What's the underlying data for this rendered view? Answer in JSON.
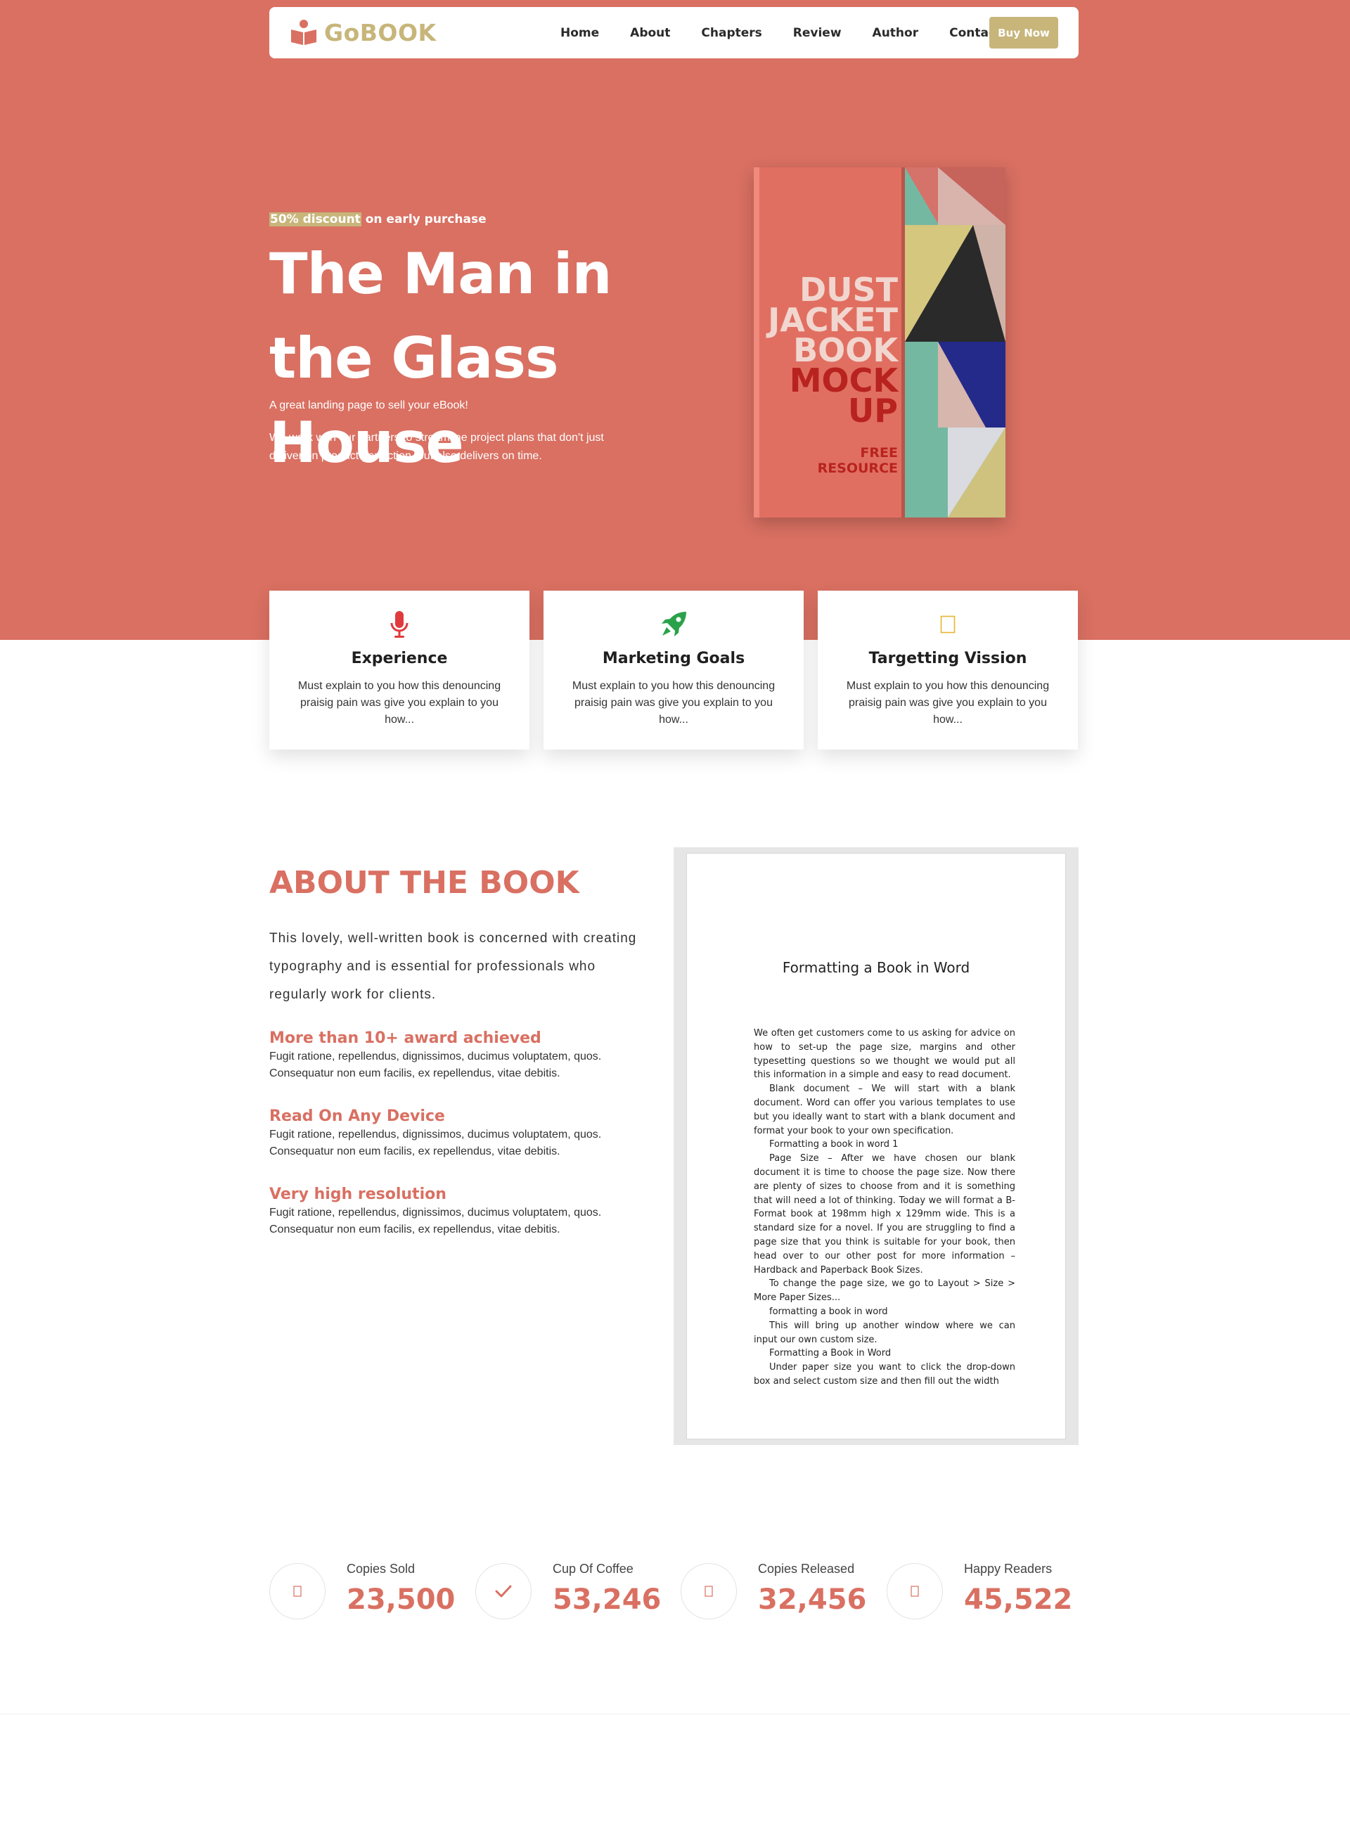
{
  "brand": {
    "name": "GoBOOK",
    "color": "#c7b57a",
    "accent": "#d97062"
  },
  "nav": {
    "items": [
      "Home",
      "About",
      "Chapters",
      "Review",
      "Author",
      "Contact"
    ],
    "cta": "Buy Now"
  },
  "hero": {
    "kicker_highlight": "50% discount",
    "kicker_rest": " on early purchase",
    "title": "The Man in the Glass House",
    "tagline": "A great landing page to sell your eBook!",
    "description": "We work with our partners to streamline project plans that don't just deliver on product perfection, but also delivers on time.",
    "book_cover": {
      "lines": [
        "DUST",
        "JACKET",
        "BOOK",
        "MOCK",
        "UP"
      ],
      "footer": [
        "FREE",
        "RESOURCE"
      ]
    }
  },
  "features": [
    {
      "icon": "microphone-icon",
      "title": "Experience",
      "text": "Must explain to you how this denouncing praisig pain was give you explain to you how..."
    },
    {
      "icon": "rocket-icon",
      "title": "Marketing Goals",
      "text": "Must explain to you how this denouncing praisig pain was give you explain to you how..."
    },
    {
      "icon": "missing-glyph-icon",
      "title": "Targetting Vission",
      "text": "Must explain to you how this denouncing praisig pain was give you explain to you how..."
    }
  ],
  "about": {
    "title": "ABOUT THE BOOK",
    "lead": "This lovely, well-written book is concerned with creating typography and is essential for professionals who regularly work for clients.",
    "points": [
      {
        "title": "More than 10+ award achieved",
        "text": "Fugit ratione, repellendus, dignissimos, ducimus voluptatem, quos. Consequatur non eum facilis, ex repellendus, vitae debitis."
      },
      {
        "title": "Read On Any Device",
        "text": "Fugit ratione, repellendus, dignissimos, ducimus voluptatem, quos. Consequatur non eum facilis, ex repellendus, vitae debitis."
      },
      {
        "title": "Very high resolution",
        "text": "Fugit ratione, repellendus, dignissimos, ducimus voluptatem, quos. Consequatur non eum facilis, ex repellendus, vitae debitis."
      }
    ],
    "document": {
      "title": "Formatting a Book in Word",
      "paragraphs": [
        {
          "text": "We often get customers come to us asking for advice on how to set-up the page size, margins and other typesetting questions so we thought we would put all this information in a simple and easy to read document.",
          "indent": false
        },
        {
          "text": "Blank document – We will start with a blank document. Word can offer you various templates to use but you ideally want to start with a blank document and format your book to your own specification.",
          "indent": true
        },
        {
          "text": "Formatting a book in word 1",
          "indent": true
        },
        {
          "text": "Page Size – After we have chosen our blank document it is time to choose the page size. Now there are plenty of sizes to choose from and it is something that will need a lot of thinking. Today we will format a B-Format book at 198mm high x 129mm wide. This is a standard size for a novel. If you are struggling to find a page size that you think is suitable for your book, then head over to our other post for more information – Hardback and Paperback Book Sizes.",
          "indent": true
        },
        {
          "text": "To change the page size, we go to Layout > Size > More Paper Sizes...",
          "indent": true
        },
        {
          "text": "formatting a book in word",
          "indent": true
        },
        {
          "text": "This will bring up another window where we can input our own custom size.",
          "indent": true
        },
        {
          "text": "Formatting a Book in Word",
          "indent": true
        },
        {
          "text": "Under paper size you want to click the drop-down box and select custom size and then fill out the width",
          "indent": true
        }
      ]
    }
  },
  "stats": [
    {
      "icon": "missing-glyph-icon",
      "label": "Copies Sold",
      "value": "23,500"
    },
    {
      "icon": "checkmark-icon",
      "label": "Cup Of Coffee",
      "value": "53,246"
    },
    {
      "icon": "missing-glyph-icon",
      "label": "Copies Released",
      "value": "32,456"
    },
    {
      "icon": "missing-glyph-icon",
      "label": "Happy Readers",
      "value": "45,522"
    }
  ]
}
